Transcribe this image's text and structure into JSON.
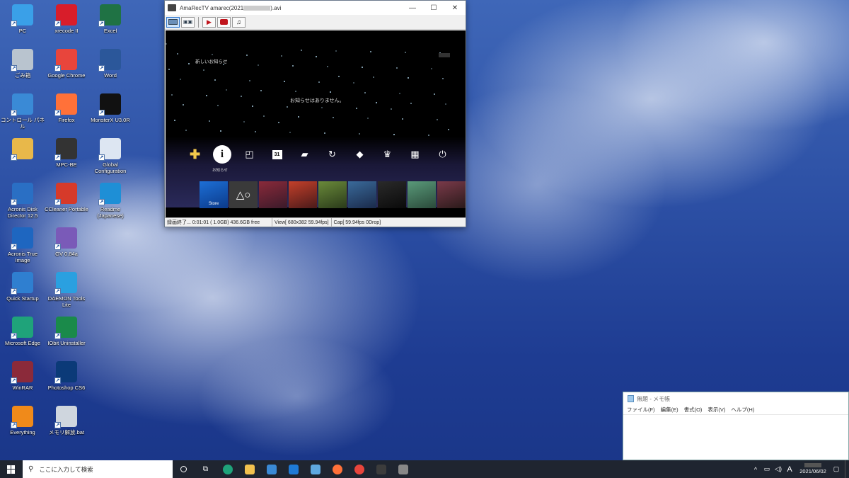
{
  "desktop_icons": [
    {
      "label": "PC",
      "icon": "pc-icon",
      "color": "#3aa0e8"
    },
    {
      "label": "xrecode II",
      "icon": "xrecode-icon",
      "color": "#d81d2a"
    },
    {
      "label": "Excel",
      "icon": "excel-icon",
      "color": "#1f7244"
    },
    {
      "label": "ごみ箱",
      "icon": "recycle-bin-icon",
      "color": "#b9c4cf"
    },
    {
      "label": "Google Chrome",
      "icon": "chrome-icon",
      "color": "#e8453c"
    },
    {
      "label": "Word",
      "icon": "word-icon",
      "color": "#2b579a"
    },
    {
      "label": "コントロール パネル",
      "icon": "control-panel-icon",
      "color": "#3a8ad6"
    },
    {
      "label": "Firefox",
      "icon": "firefox-icon",
      "color": "#ff7139"
    },
    {
      "label": "MonsterX U3.0R",
      "icon": "monsterx-icon",
      "color": "#111111"
    },
    {
      "label": "",
      "icon": "user-folder-icon",
      "color": "#e8b84a"
    },
    {
      "label": "MPC-BE",
      "icon": "mpc-be-icon",
      "color": "#333333"
    },
    {
      "label": "Global Configuration",
      "icon": "file-icon",
      "color": "#dde6f2"
    },
    {
      "label": "Acronis Disk Director 12.5",
      "icon": "acronis-disk-icon",
      "color": "#2a6fc4"
    },
    {
      "label": "CCleaner Portable",
      "icon": "ccleaner-icon",
      "color": "#d63a2a"
    },
    {
      "label": "Readme (Japanese)",
      "icon": "edge-file-icon",
      "color": "#1e8fd6"
    },
    {
      "label": "Acronis True Image",
      "icon": "acronis-true-image-icon",
      "color": "#1e66c0"
    },
    {
      "label": "GV 0.84a",
      "icon": "gv-icon",
      "color": "#7a5ab8"
    },
    {
      "label": "Quick Startup",
      "icon": "quick-startup-icon",
      "color": "#2f7fd0"
    },
    {
      "label": "DAEMON Tools Lite",
      "icon": "daemon-tools-icon",
      "color": "#2aa0e0"
    },
    {
      "label": "Microsoft Edge",
      "icon": "edge-icon",
      "color": "#1fa37a"
    },
    {
      "label": "IObit Uninstaller",
      "icon": "iobit-icon",
      "color": "#1a8a4a"
    },
    {
      "label": "WinRAR",
      "icon": "winrar-icon",
      "color": "#8b2a3a"
    },
    {
      "label": "Photoshop CS6",
      "icon": "photoshop-icon",
      "color": "#0b3a78"
    },
    {
      "label": "Everything",
      "icon": "everything-icon",
      "color": "#f08a1a"
    },
    {
      "label": "メモリ解放.bat",
      "icon": "bat-file-icon",
      "color": "#cfd6de"
    }
  ],
  "amarec": {
    "title": "AmaRecTV amarec(2021",
    "title_suffix": ").avi",
    "screen": {
      "notice_header": "新しいお知らせ",
      "no_notice": "お知らせはありません。",
      "info_label": "お知らせ",
      "store_label": "Store"
    },
    "status": {
      "record": "録画終了... 0:01:01 ( 1.0GB) 436.6GB free",
      "view": "View[ 680x382 59.94fps]",
      "cap": "Cap[ 59.94fps 0Drop]"
    }
  },
  "notepad": {
    "title": "無題 - メモ帳",
    "menu": [
      "ファイル(F)",
      "編集(E)",
      "書式(O)",
      "表示(V)",
      "ヘルプ(H)"
    ]
  },
  "taskbar": {
    "search_placeholder": "ここに入力して検索",
    "apps": [
      {
        "icon": "edge-icon",
        "color": "#1fa37a"
      },
      {
        "icon": "file-explorer-icon",
        "color": "#f2c14e"
      },
      {
        "icon": "store-icon",
        "color": "#3a8ad6"
      },
      {
        "icon": "mail-icon",
        "color": "#1e7ad6"
      },
      {
        "icon": "app-icon",
        "color": "#5fa8e0"
      },
      {
        "icon": "firefox-icon",
        "color": "#ff7139"
      },
      {
        "icon": "chrome-icon",
        "color": "#e8453c"
      },
      {
        "icon": "calculator-icon",
        "color": "#3c3c3c"
      },
      {
        "icon": "amarectv-icon",
        "color": "#888888"
      }
    ],
    "ime": "A",
    "date": "2021/06/02"
  }
}
